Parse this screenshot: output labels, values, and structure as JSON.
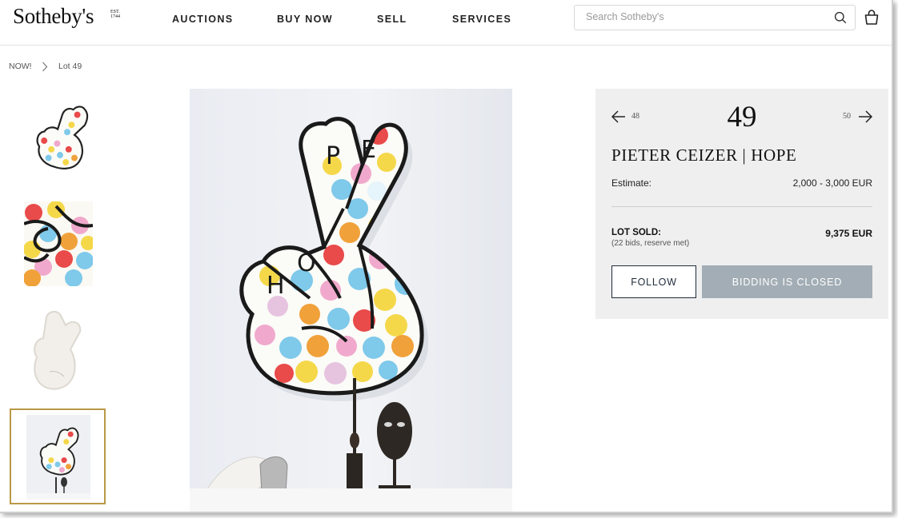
{
  "header": {
    "logo": "Sotheby's",
    "logo_est": "EST. 1744",
    "nav": [
      "AUCTIONS",
      "BUY NOW",
      "SELL",
      "SERVICES"
    ],
    "search_placeholder": "Search Sotheby's"
  },
  "breadcrumb": [
    "NOW!",
    "Lot 49"
  ],
  "gallery": {
    "thumbnail_count": 4,
    "selected_index": 3,
    "artwork_letters": [
      "P",
      "E",
      "H",
      "O"
    ]
  },
  "lot": {
    "prev_lot": "48",
    "number": "49",
    "next_lot": "50",
    "title": "PIETER CEIZER | HOPE",
    "estimate_label": "Estimate:",
    "estimate_value": "2,000 - 3,000 EUR",
    "sold_label": "LOT SOLD:",
    "sold_details": "(22 bids, reserve met)",
    "sold_price": "9,375 EUR",
    "follow_label": "FOLLOW",
    "bidding_label": "BIDDING IS CLOSED"
  },
  "colors": {
    "accent_gold": "#b99945",
    "button_disabled": "#a2adb5",
    "panel_bg": "#efefef",
    "dot_palette": [
      "#f5d84a",
      "#7fc9ea",
      "#e94a4a",
      "#f0a13a",
      "#f0a9cc",
      "#9fd6c4"
    ]
  }
}
